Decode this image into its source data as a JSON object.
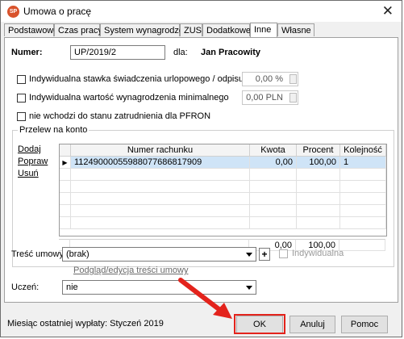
{
  "window": {
    "title": "Umowa o pracę",
    "app_icon_text": "SP"
  },
  "tabs": [
    {
      "label": "Podstawowe"
    },
    {
      "label": "Czas pracy"
    },
    {
      "label": "System wynagrodzeń"
    },
    {
      "label": "ZUS"
    },
    {
      "label": "Dodatkowe"
    },
    {
      "label": "Inne",
      "active": true
    },
    {
      "label": "Własne"
    }
  ],
  "form": {
    "numer_label": "Numer:",
    "numer_value": "UP/2019/2",
    "dla_label": "dla:",
    "employee_name": "Jan Pracowity",
    "option1_label": "Indywidualna stawka świadczenia urlopowego / odpisu na ZFŚS",
    "option1_value": "0,00 %",
    "option2_label": "Indywidualna wartość wynagrodzenia minimalnego",
    "option2_value": "0,00 PLN",
    "option3_label": "nie wchodzi do stanu zatrudnienia dla PFRON"
  },
  "transfer": {
    "group_label": "Przelew na konto",
    "links": {
      "add": "Dodaj",
      "edit": "Popraw",
      "delete": "Usuń"
    },
    "columns": {
      "account": "Numer rachunku",
      "amount": "Kwota",
      "percent": "Procent",
      "order": "Kolejność"
    },
    "rows": [
      {
        "marker": "▶",
        "account": "11249000055988077686817909",
        "amount": "0,00",
        "percent": "100,00",
        "order": "1"
      }
    ],
    "totals": {
      "amount": "0,00",
      "percent": "100,00"
    }
  },
  "content": {
    "tresc_label": "Treść umowy:",
    "tresc_value": "(brak)",
    "plus_label": "+",
    "individual_label": "Indywidualna",
    "edit_link": "Podgląd/edycja treści umowy",
    "uczen_label": "Uczeń:",
    "uczen_value": "nie"
  },
  "footer": {
    "status": "Miesiąc ostatniej wypłaty: Styczeń 2019",
    "ok": "OK",
    "cancel": "Anuluj",
    "help": "Pomoc"
  },
  "colors": {
    "highlight": "#e3231c",
    "selected_row": "#cfe4f7",
    "app_icon": "#d9532c"
  }
}
